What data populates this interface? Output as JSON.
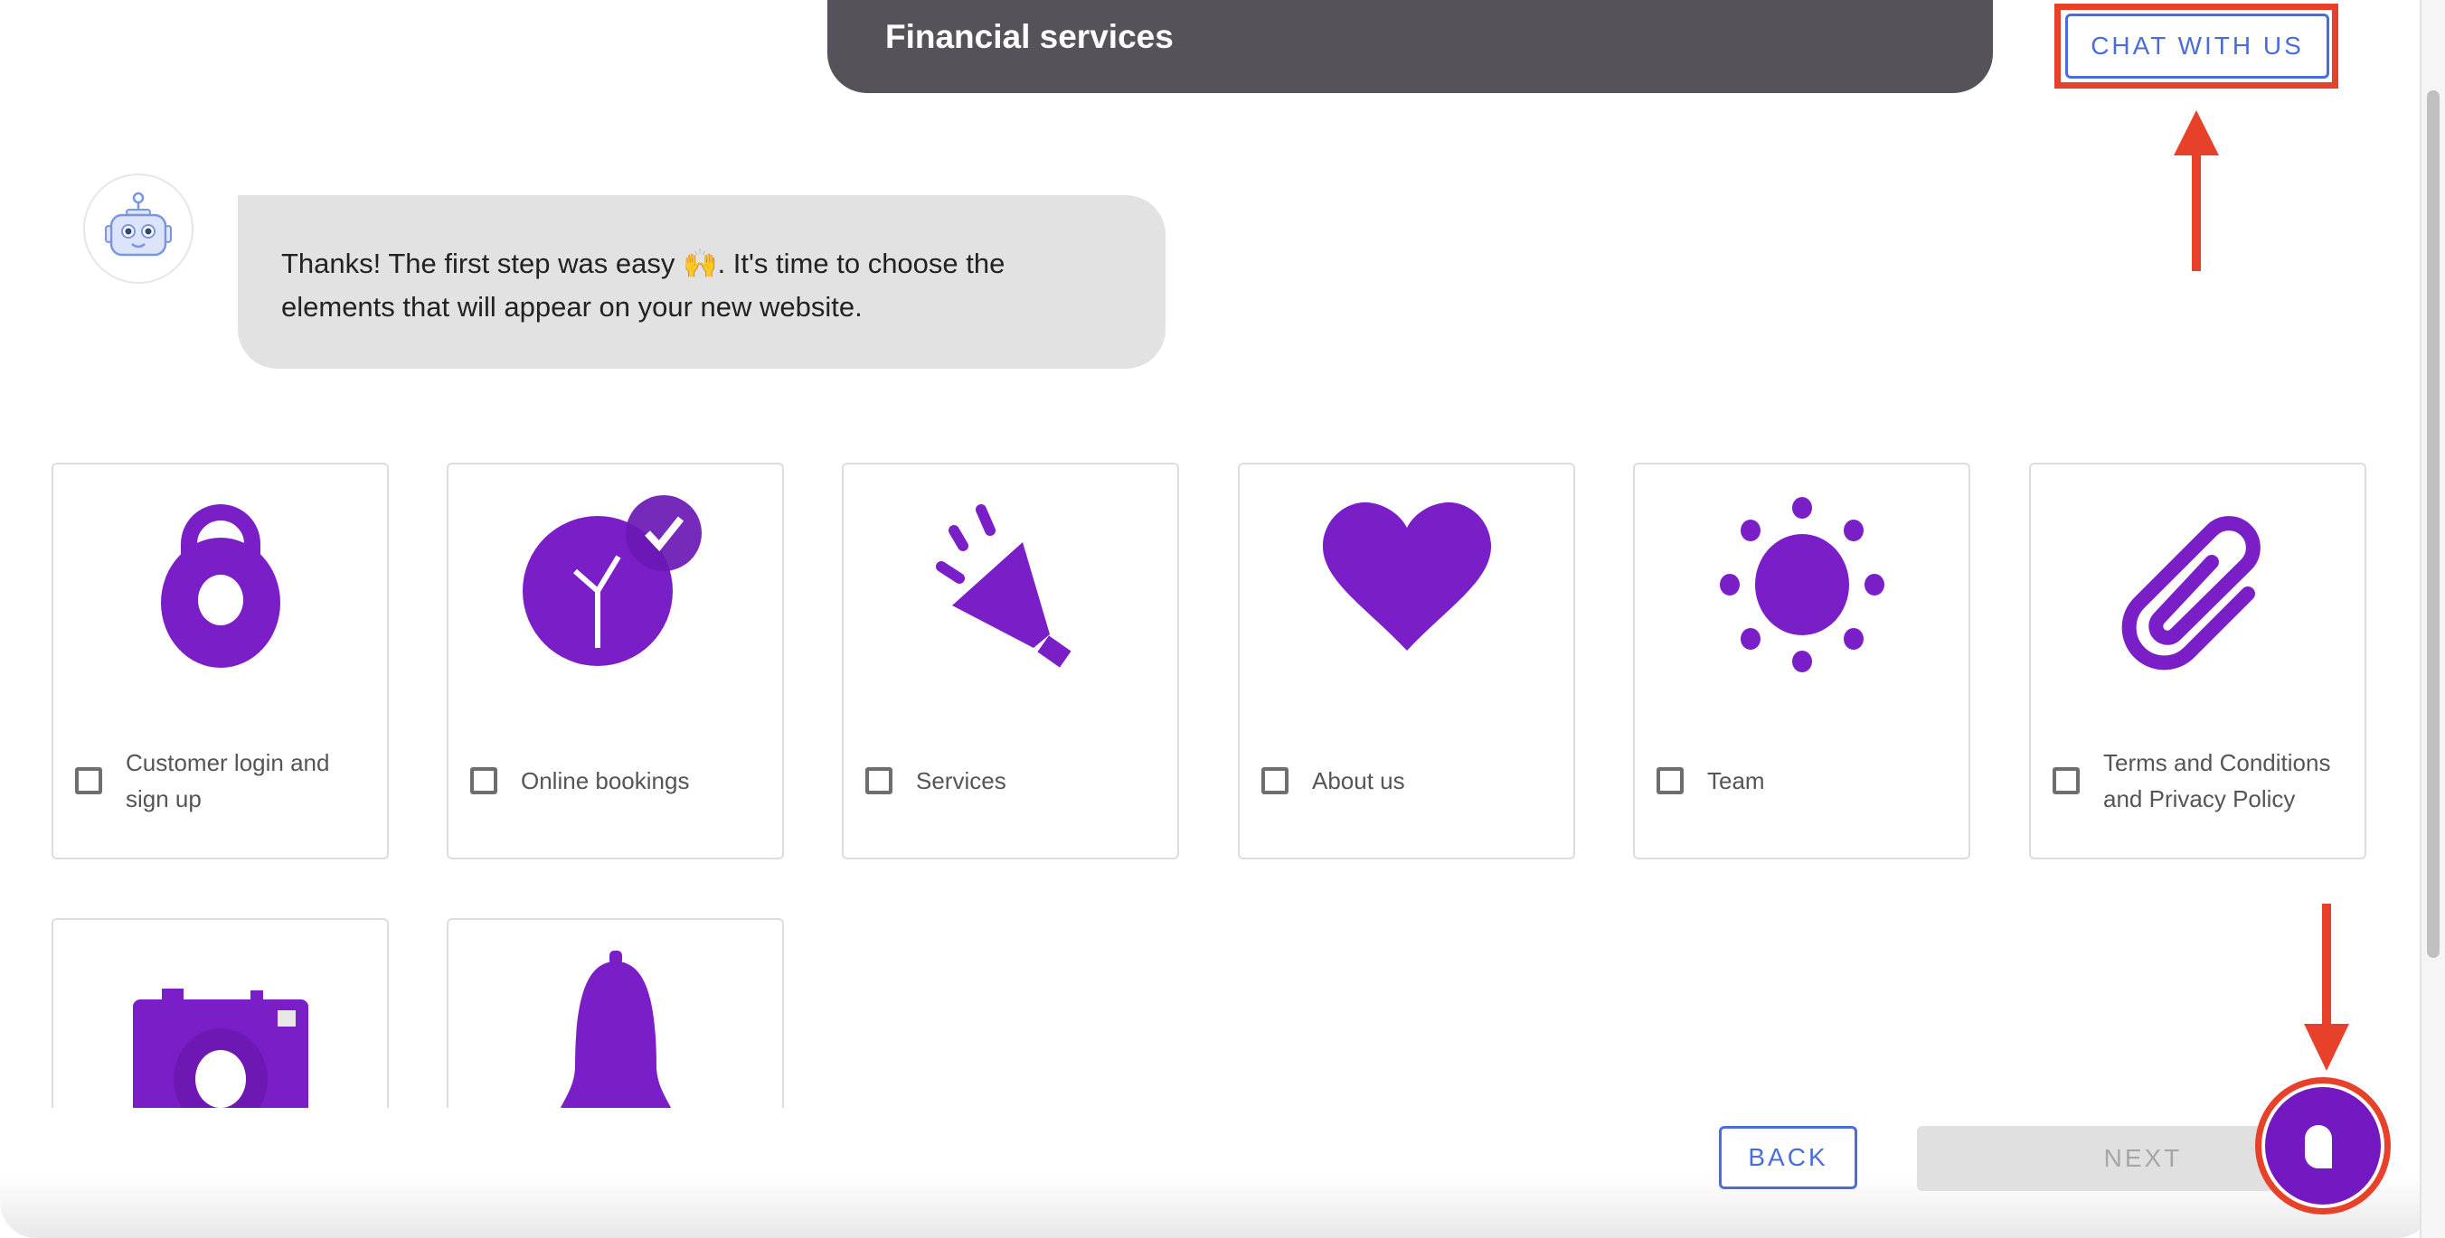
{
  "header": {
    "title": "Financial services"
  },
  "chat_with_us": {
    "label": "CHAT WITH US"
  },
  "bot": {
    "avatar_icon": "robot-icon",
    "message_before_emoji": "Thanks! The first step was easy ",
    "emoji": "🙌",
    "message_after_emoji": ". It's time to choose the elements that will appear on your new website."
  },
  "options": [
    {
      "label": "Customer login and sign up",
      "icon": "padlock-icon",
      "checked": false
    },
    {
      "label": "Online bookings",
      "icon": "clock-check-icon",
      "checked": false
    },
    {
      "label": "Services",
      "icon": "megaphone-icon",
      "checked": false
    },
    {
      "label": "About us",
      "icon": "heart-icon",
      "checked": false
    },
    {
      "label": "Team",
      "icon": "sun-icon",
      "checked": false
    },
    {
      "label": "Terms and Conditions and Privacy Policy",
      "icon": "paperclip-icon",
      "checked": false
    },
    {
      "label": "",
      "icon": "camera-icon",
      "checked": false
    },
    {
      "label": "",
      "icon": "bell-icon",
      "checked": false
    }
  ],
  "footer": {
    "back_label": "BACK",
    "next_label": "NEXT",
    "next_disabled": true
  },
  "chat_fab": {
    "icon": "chat-bubble-icon"
  },
  "colors": {
    "accent_purple": "#7419c2",
    "button_blue": "#4a6ddc",
    "header_gray": "#555259",
    "annotation_red": "#e8412a"
  }
}
